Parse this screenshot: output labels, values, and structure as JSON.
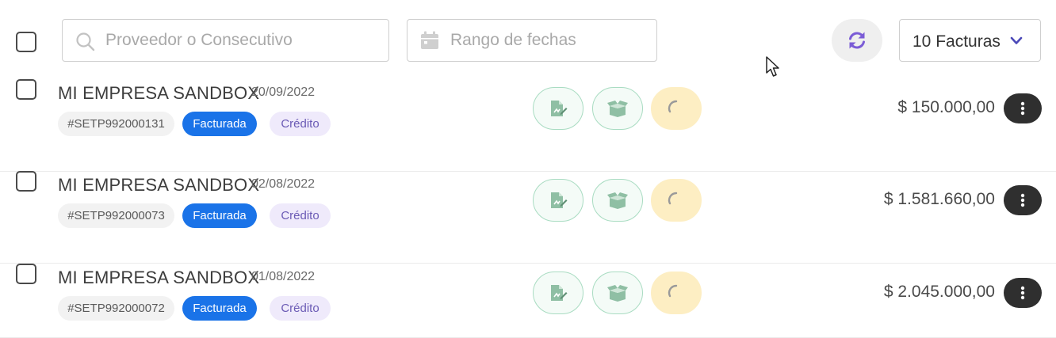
{
  "toolbar": {
    "search_placeholder": "Proveedor o Consecutivo",
    "date_placeholder": "Rango de fechas",
    "count_label": "10 Facturas"
  },
  "colors": {
    "accent": "#7b5cd6",
    "status_blue": "#1a73e8",
    "green_border": "#a9dcc2",
    "pending_yellow": "#fdeec3"
  },
  "icons": [
    "search-icon",
    "calendar-icon",
    "refresh-icon",
    "chevron-down-icon",
    "signature-icon",
    "box-icon",
    "spinner-icon",
    "more-vertical-icon"
  ],
  "invoices": [
    {
      "company": "MI EMPRESA SANDBOX",
      "date": "20/09/2022",
      "consecutive": "#SETP992000131",
      "status": "Facturada",
      "type": "Crédito",
      "amount": "$ 150.000,00"
    },
    {
      "company": "MI EMPRESA SANDBOX",
      "date": "02/08/2022",
      "consecutive": "#SETP992000073",
      "status": "Facturada",
      "type": "Crédito",
      "amount": "$ 1.581.660,00"
    },
    {
      "company": "MI EMPRESA SANDBOX",
      "date": "01/08/2022",
      "consecutive": "#SETP992000072",
      "status": "Facturada",
      "type": "Crédito",
      "amount": "$ 2.045.000,00"
    }
  ]
}
